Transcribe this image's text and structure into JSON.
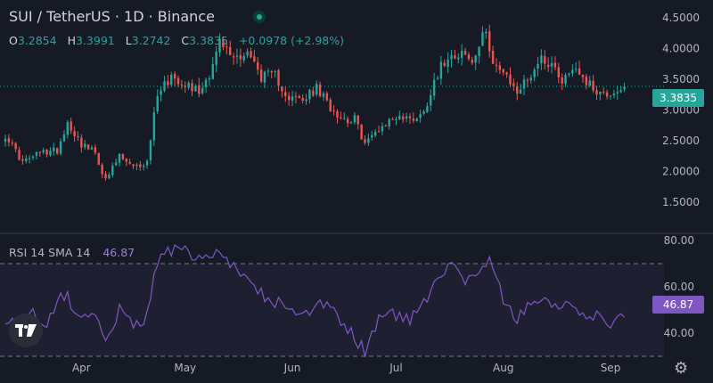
{
  "header": {
    "title": "SUI / TetherUS · 1D · Binance",
    "ohlc": {
      "o_label": "O",
      "o_value": "3.2854",
      "h_label": "H",
      "h_value": "3.3991",
      "l_label": "L",
      "l_value": "3.2742",
      "c_label": "C",
      "c_value": "3.3835",
      "change": "+0.0978 (+2.98%)"
    }
  },
  "rsi_legend": {
    "label": "RSI 14 SMA 14",
    "value": "46.87"
  },
  "last_price_label": "3.3835",
  "rsi_last_label": "46.87",
  "colors": {
    "up": "#26a69a",
    "down": "#ef5350",
    "rsi_line": "#7e57c2",
    "rsi_band": "#7e57c2",
    "background": "#161a25",
    "text": "#d1d4dc"
  },
  "icons": {
    "logo": "tradingview-logo-icon",
    "settings": "gear-icon",
    "status": "market-status-dot-icon"
  },
  "chart_data": [
    {
      "type": "candlestick",
      "title": "SUI / TetherUS · 1D · Binance",
      "y_ticks": [
        "1.5000",
        "2.0000",
        "2.5000",
        "3.0000",
        "3.5000",
        "4.0000",
        "4.5000"
      ],
      "ylim": [
        1.5,
        4.5
      ],
      "x_ticks": [
        "Apr",
        "May",
        "Jun",
        "Jul",
        "Aug",
        "Sep"
      ],
      "grid": false,
      "last_price": 3.3835,
      "anchors": [
        [
          "Mar 10",
          2.6
        ],
        [
          "Mar 15",
          2.15
        ],
        [
          "Mar 20",
          2.3
        ],
        [
          "Mar 25",
          2.35
        ],
        [
          "Mar 28",
          2.8
        ],
        [
          "Apr 1",
          2.45
        ],
        [
          "Apr 5",
          2.3
        ],
        [
          "Apr 8",
          1.85
        ],
        [
          "Apr 12",
          2.25
        ],
        [
          "Apr 16",
          2.05
        ],
        [
          "Apr 20",
          2.15
        ],
        [
          "Apr 23",
          3.3
        ],
        [
          "Apr 27",
          3.55
        ],
        [
          "May 1",
          3.45
        ],
        [
          "May 5",
          3.3
        ],
        [
          "May 8",
          3.6
        ],
        [
          "May 11",
          4.1
        ],
        [
          "May 15",
          3.85
        ],
        [
          "May 19",
          3.95
        ],
        [
          "May 23",
          3.55
        ],
        [
          "May 27",
          3.55
        ],
        [
          "May 31",
          3.2
        ],
        [
          "Jun 4",
          3.15
        ],
        [
          "Jun 8",
          3.35
        ],
        [
          "Jun 12",
          3.05
        ],
        [
          "Jun 16",
          2.85
        ],
        [
          "Jun 19",
          2.85
        ],
        [
          "Jun 22",
          2.45
        ],
        [
          "Jun 26",
          2.7
        ],
        [
          "Jul 1",
          2.9
        ],
        [
          "Jul 5",
          2.85
        ],
        [
          "Jul 9",
          2.95
        ],
        [
          "Jul 12",
          3.5
        ],
        [
          "Jul 16",
          3.9
        ],
        [
          "Jul 20",
          3.95
        ],
        [
          "Jul 23",
          3.75
        ],
        [
          "Jul 27",
          4.3
        ],
        [
          "Jul 29",
          3.8
        ],
        [
          "Aug 2",
          3.5
        ],
        [
          "Aug 5",
          3.3
        ],
        [
          "Aug 8",
          3.5
        ],
        [
          "Aug 12",
          3.85
        ],
        [
          "Aug 15",
          3.75
        ],
        [
          "Aug 18",
          3.5
        ],
        [
          "Aug 22",
          3.7
        ],
        [
          "Aug 26",
          3.4
        ],
        [
          "Aug 30",
          3.25
        ],
        [
          "Sep 2",
          3.3
        ],
        [
          "Sep 5",
          3.3835
        ]
      ]
    },
    {
      "type": "line",
      "title": "RSI 14 SMA 14",
      "y_ticks": [
        "40.00",
        "60.00",
        "80.00"
      ],
      "ylim": [
        30,
        80
      ],
      "bands": [
        30,
        70
      ],
      "last_value": 46.87,
      "anchors": [
        [
          "Mar 10",
          46
        ],
        [
          "Mar 14",
          42
        ],
        [
          "Mar 18",
          48
        ],
        [
          "Mar 22",
          45
        ],
        [
          "Mar 27",
          57
        ],
        [
          "Apr 1",
          48
        ],
        [
          "Apr 5",
          45
        ],
        [
          "Apr 8",
          38
        ],
        [
          "Apr 12",
          50
        ],
        [
          "Apr 16",
          44
        ],
        [
          "Apr 20",
          47
        ],
        [
          "Apr 23",
          72
        ],
        [
          "Apr 27",
          76
        ],
        [
          "May 1",
          75
        ],
        [
          "May 5",
          71
        ],
        [
          "May 10",
          75
        ],
        [
          "May 14",
          68
        ],
        [
          "May 19",
          67
        ],
        [
          "May 24",
          55
        ],
        [
          "May 28",
          53
        ],
        [
          "Jun 2",
          47
        ],
        [
          "Jun 6",
          47
        ],
        [
          "Jun 10",
          53
        ],
        [
          "Jun 15",
          45
        ],
        [
          "Jun 19",
          38
        ],
        [
          "Jun 22",
          32
        ],
        [
          "Jun 26",
          47
        ],
        [
          "Jul 1",
          48
        ],
        [
          "Jul 5",
          45
        ],
        [
          "Jul 10",
          56
        ],
        [
          "Jul 13",
          66
        ],
        [
          "Jul 17",
          70
        ],
        [
          "Jul 21",
          63
        ],
        [
          "Jul 24",
          66
        ],
        [
          "Jul 28",
          72
        ],
        [
          "Aug 1",
          55
        ],
        [
          "Aug 5",
          44
        ],
        [
          "Aug 8",
          54
        ],
        [
          "Aug 12",
          55
        ],
        [
          "Aug 16",
          50
        ],
        [
          "Aug 20",
          55
        ],
        [
          "Aug 25",
          44
        ],
        [
          "Aug 29",
          48
        ],
        [
          "Sep 2",
          43
        ],
        [
          "Sep 5",
          46.87
        ]
      ]
    }
  ]
}
